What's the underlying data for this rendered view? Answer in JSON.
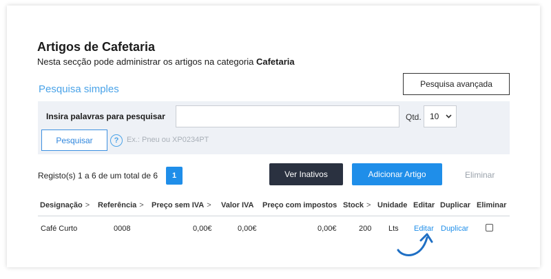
{
  "page": {
    "title": "Artigos de Cafetaria",
    "subtitle_prefix": "Nesta secção pode administrar os artigos na categoria ",
    "subtitle_category": "Cafetaria"
  },
  "search": {
    "section_title": "Pesquisa simples",
    "advanced_button": "Pesquisa avançada",
    "keywords_label": "Insira palavras para pesquisar",
    "keywords_value": "",
    "qty_label": "Qtd.",
    "qty_value": "10",
    "search_button": "Pesquisar",
    "hint": "Ex.: Pneu ou XP0234PT"
  },
  "toolbar": {
    "records_text": "Registo(s) 1 a 6 de um total de 6",
    "current_page": "1",
    "inactive_button": "Ver Inativos",
    "add_button": "Adicionar Artigo",
    "delete_link": "Eliminar"
  },
  "table": {
    "headers": [
      "Designação",
      "Referência",
      "Preço sem IVA",
      "Valor IVA",
      "Preço com impostos",
      "Stock",
      "Unidade",
      "Editar",
      "Duplicar",
      "Eliminar"
    ],
    "header_arrow": ">",
    "rows": [
      {
        "designacao": "Café Curto",
        "referencia": "0008",
        "preco_sem_iva": "0,00€",
        "valor_iva": "0,00€",
        "preco_com_impostos": "0,00€",
        "stock": "200",
        "unidade": "Lts",
        "editar": "Editar",
        "duplicar": "Duplicar",
        "eliminar_checked": false
      }
    ]
  },
  "colors": {
    "accent": "#1f8ee9",
    "dark_button": "#2a3140",
    "section_title": "#4aa3e8",
    "panel_bg": "#eef1f6"
  }
}
